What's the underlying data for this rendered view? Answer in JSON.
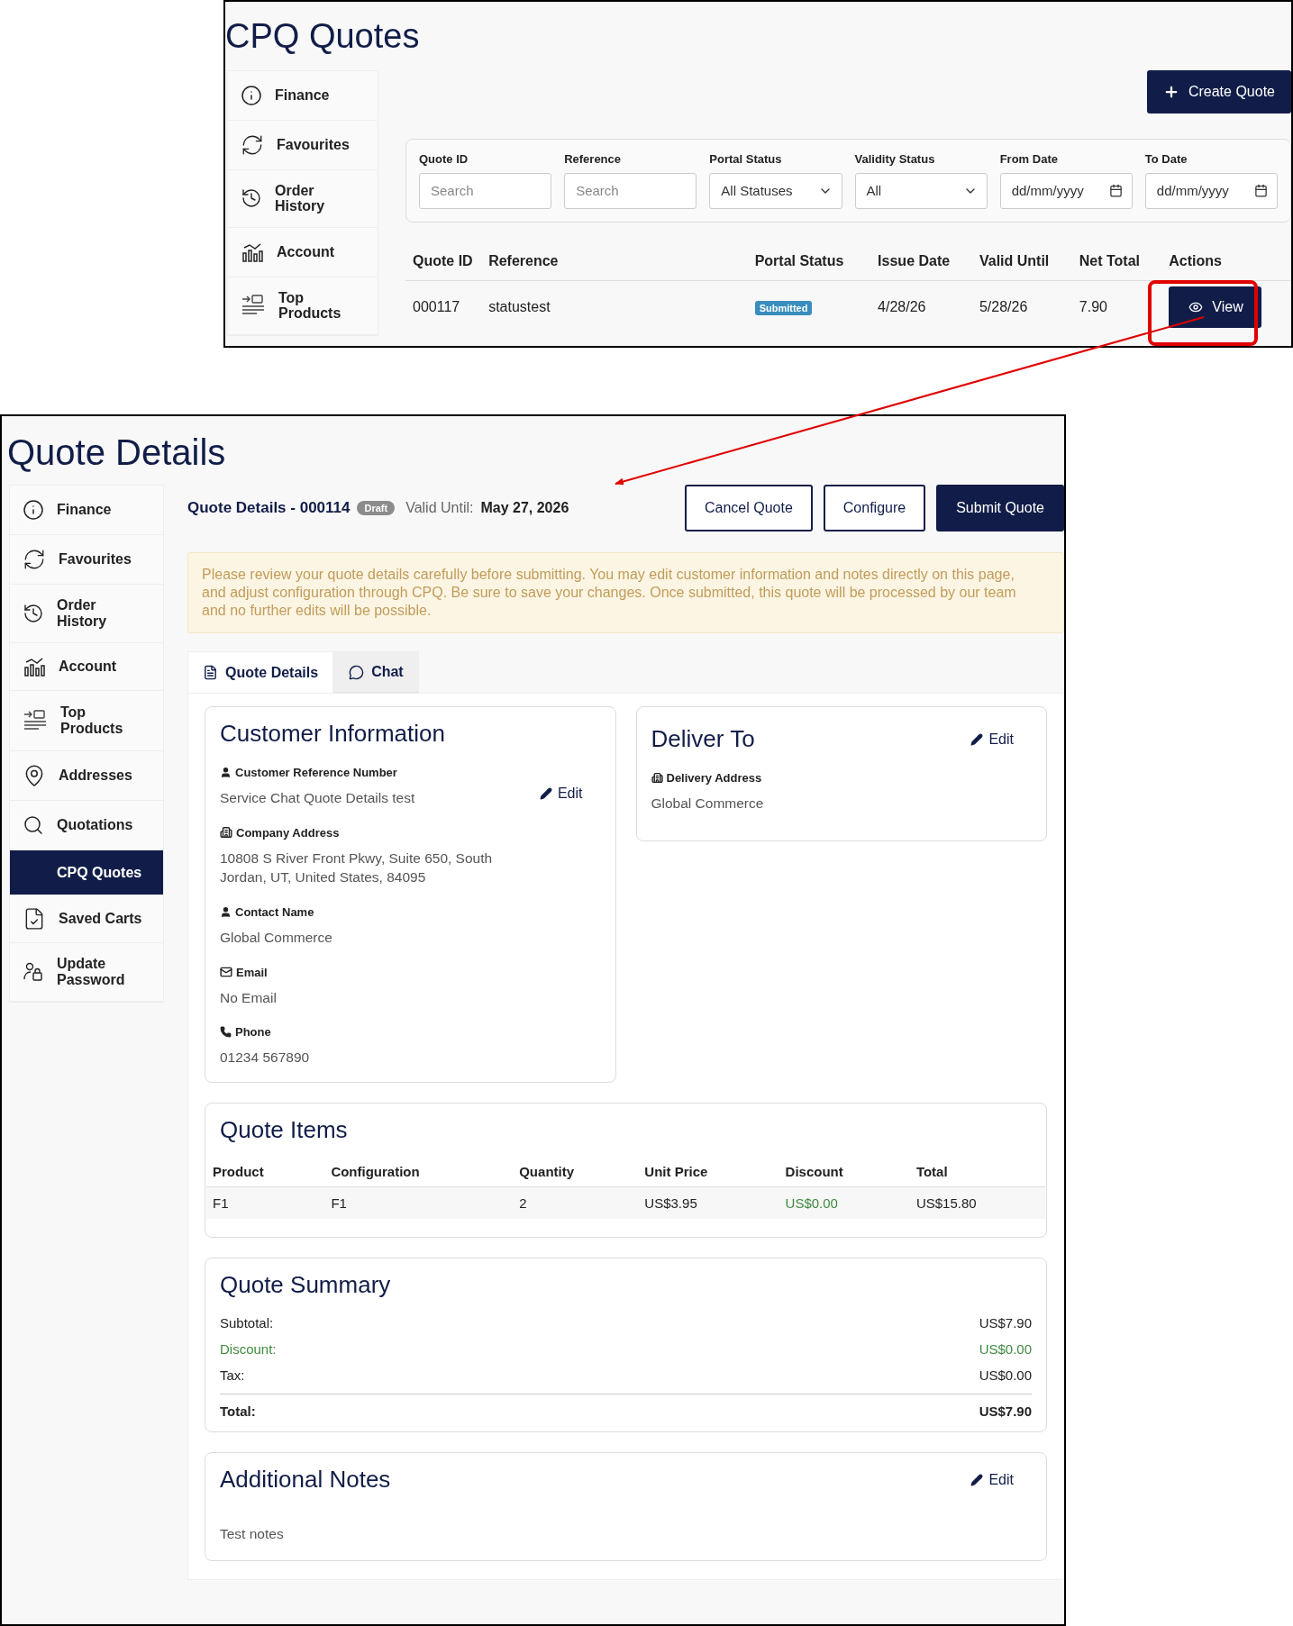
{
  "list_screen": {
    "title": "CPQ Quotes",
    "sidebar": [
      {
        "label": "Finance"
      },
      {
        "label": "Favourites"
      },
      {
        "label": "Order History"
      },
      {
        "label": "Account"
      },
      {
        "label": "Top Products"
      }
    ],
    "create_button": "Create Quote",
    "filters": [
      {
        "label": "Quote ID",
        "kind": "text",
        "placeholder": "Search"
      },
      {
        "label": "Reference",
        "kind": "text",
        "placeholder": "Search"
      },
      {
        "label": "Portal Status",
        "kind": "select",
        "value": "All Statuses"
      },
      {
        "label": "Validity Status",
        "kind": "select",
        "value": "All"
      },
      {
        "label": "From Date",
        "kind": "date",
        "placeholder": "dd/mm/yyyy"
      },
      {
        "label": "To Date",
        "kind": "date",
        "placeholder": "dd/mm/yyyy"
      }
    ],
    "table": {
      "columns": [
        "Quote ID",
        "Reference",
        "Portal Status",
        "Issue Date",
        "Valid Until",
        "Net Total",
        "Actions"
      ],
      "rows": [
        {
          "quote_id": "000117",
          "reference": "statustest",
          "status": "Submitted",
          "issue_date": "4/28/26",
          "valid_until": "5/28/26",
          "net_total": "7.90",
          "action": "View"
        }
      ]
    }
  },
  "detail_screen": {
    "title": "Quote Details",
    "sidebar": [
      {
        "label": "Finance",
        "selected": false
      },
      {
        "label": "Favourites",
        "selected": false
      },
      {
        "label": "Order History",
        "selected": false
      },
      {
        "label": "Account",
        "selected": false
      },
      {
        "label": "Top Products",
        "selected": false
      },
      {
        "label": "Addresses",
        "selected": false
      },
      {
        "label": "Quotations",
        "selected": false
      },
      {
        "label": "CPQ Quotes",
        "selected": true
      },
      {
        "label": "Saved Carts",
        "selected": false
      },
      {
        "label": "Update Password",
        "selected": false
      }
    ],
    "header": {
      "title": "Quote Details - 000114",
      "status": "Draft",
      "valid_label": "Valid Until:",
      "valid_date": "May 27, 2026"
    },
    "buttons": [
      {
        "label": "Cancel Quote",
        "kind": "outline"
      },
      {
        "label": "Configure",
        "kind": "outline"
      },
      {
        "label": "Submit Quote",
        "kind": "primary"
      }
    ],
    "notice": "Please review your quote details carefully before submitting. You may edit customer information and notes directly on this page, and adjust configuration through CPQ. Be sure to save your changes. Once submitted, this quote will be processed by our team and no further edits will be possible.",
    "tabs": [
      {
        "label": "Quote Details",
        "selected": true
      },
      {
        "label": "Chat",
        "selected": false
      }
    ],
    "customer": {
      "title": "Customer Information",
      "edit": "Edit",
      "fields": [
        {
          "label": "Customer Reference Number",
          "value": "Service Chat Quote Details test"
        },
        {
          "label": "Company Address",
          "value": "10808 S River Front Pkwy, Suite 650, South Jordan, UT, United States, 84095"
        },
        {
          "label": "Contact Name",
          "value": "Global Commerce"
        },
        {
          "label": "Email",
          "value": "No Email"
        },
        {
          "label": "Phone",
          "value": "01234 567890"
        }
      ]
    },
    "deliver": {
      "title": "Deliver To",
      "edit": "Edit",
      "fields": [
        {
          "label": "Delivery Address",
          "value": "Global Commerce"
        }
      ]
    },
    "items": {
      "title": "Quote Items",
      "columns": [
        "Product",
        "Configuration",
        "Quantity",
        "Unit Price",
        "Discount",
        "Total"
      ],
      "rows": [
        {
          "product": "F1",
          "configuration": "F1",
          "quantity": "2",
          "unit_price": "US$3.95",
          "discount": "US$0.00",
          "total": "US$15.80"
        }
      ]
    },
    "summary": {
      "title": "Quote Summary",
      "lines": [
        {
          "label": "Subtotal:",
          "value": "US$7.90",
          "kind": "normal"
        },
        {
          "label": "Discount:",
          "value": "US$0.00",
          "kind": "discount"
        },
        {
          "label": "Tax:",
          "value": "US$0.00",
          "kind": "normal"
        },
        {
          "label": "Total:",
          "value": "US$7.90",
          "kind": "total"
        }
      ]
    },
    "notes": {
      "title": "Additional Notes",
      "edit": "Edit",
      "text": "Test notes"
    }
  }
}
